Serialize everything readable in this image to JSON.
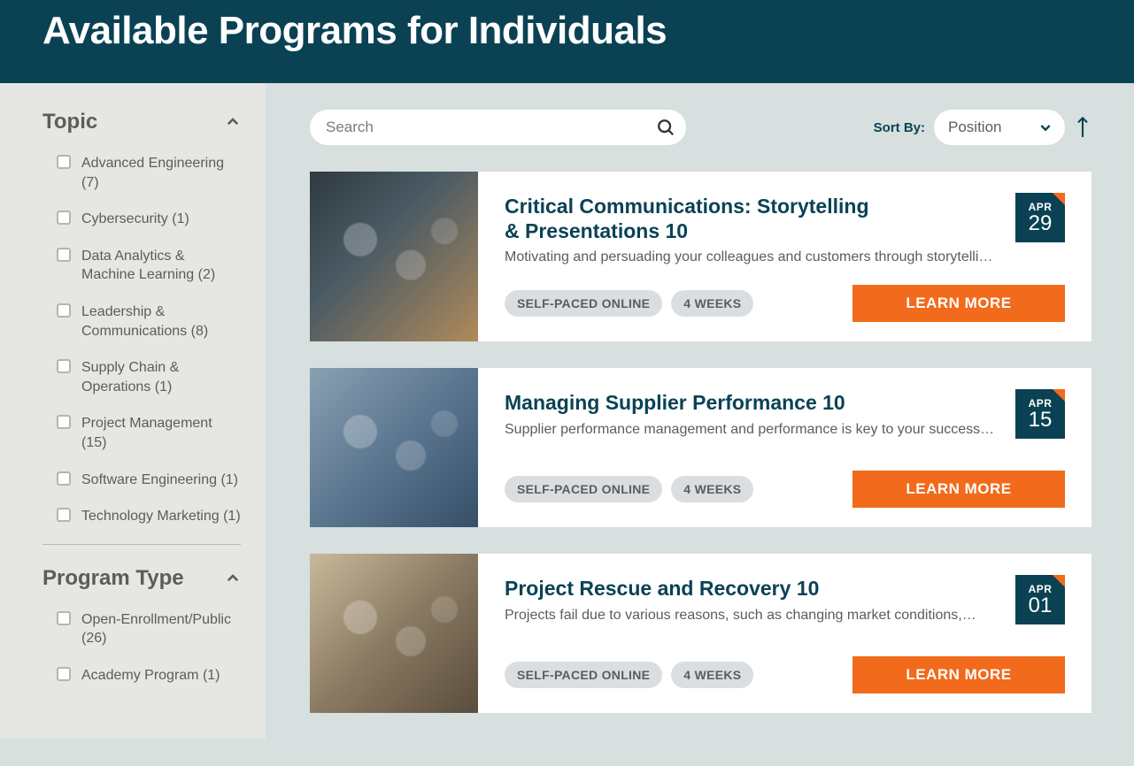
{
  "header": {
    "title": "Available Programs for Individuals"
  },
  "search": {
    "placeholder": "Search"
  },
  "sort": {
    "label": "Sort By:",
    "selected": "Position"
  },
  "filters": {
    "sections": [
      {
        "title": "Topic",
        "options": [
          {
            "label": "Advanced Engineering",
            "count": "(7)"
          },
          {
            "label": "Cybersecurity",
            "count": "(1)"
          },
          {
            "label": "Data Analytics & Machine Learning",
            "count": "(2)"
          },
          {
            "label": "Leadership & Communications",
            "count": "(8)"
          },
          {
            "label": "Supply Chain & Operations",
            "count": "(1)"
          },
          {
            "label": "Project Management",
            "count": "(15)"
          },
          {
            "label": "Software Engineering",
            "count": "(1)"
          },
          {
            "label": "Technology Marketing",
            "count": "(1)"
          }
        ]
      },
      {
        "title": "Program Type",
        "options": [
          {
            "label": "Open-Enrollment/Public",
            "count": "(26)"
          },
          {
            "label": "Academy Program",
            "count": "(1)"
          }
        ]
      }
    ]
  },
  "programs": [
    {
      "title": "Critical Communications: Storytelling & Presentations 10",
      "desc": "Motivating and persuading your colleagues and customers through storytelli…",
      "tags": [
        "SELF-PACED ONLINE",
        "4 WEEKS"
      ],
      "cta": "LEARN MORE",
      "date": {
        "month": "APR",
        "day": "29"
      },
      "imgclass": "img-a"
    },
    {
      "title": "Managing Supplier Performance 10",
      "desc": "Supplier performance management and performance is key to your success…",
      "tags": [
        "SELF-PACED ONLINE",
        "4 WEEKS"
      ],
      "cta": "LEARN MORE",
      "date": {
        "month": "APR",
        "day": "15"
      },
      "imgclass": "img-b"
    },
    {
      "title": "Project Rescue and Recovery 10",
      "desc": "Projects fail due to various reasons, such as changing market conditions,…",
      "tags": [
        "SELF-PACED ONLINE",
        "4 WEEKS"
      ],
      "cta": "LEARN MORE",
      "date": {
        "month": "APR",
        "day": "01"
      },
      "imgclass": "img-c"
    }
  ]
}
